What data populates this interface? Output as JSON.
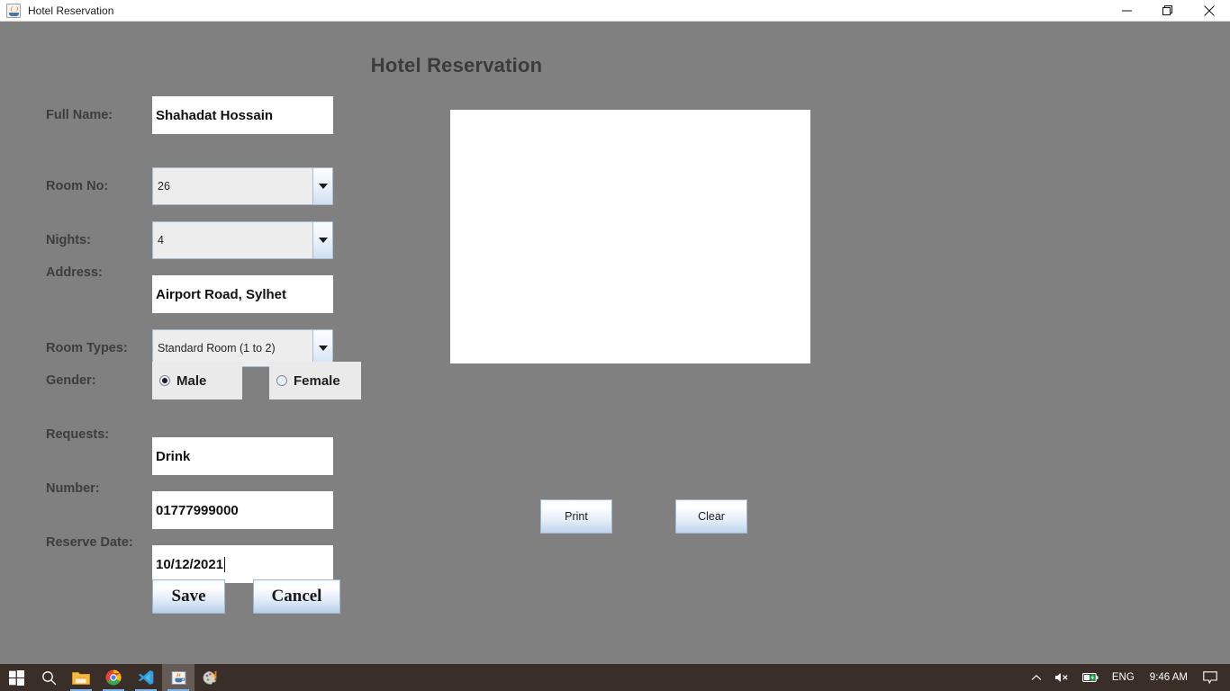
{
  "window": {
    "title": "Hotel Reservation",
    "app_icon": "java-coffee-cup-icon",
    "controls": {
      "minimize": "minimize-icon",
      "restore": "restore-icon",
      "close": "close-icon"
    }
  },
  "page": {
    "heading": "Hotel Reservation"
  },
  "form": {
    "fields": [
      {
        "label": "Full Name:",
        "type": "text",
        "value": "Shahadat Hossain",
        "name": "full-name"
      },
      {
        "label": "Room No:",
        "type": "combo",
        "value": "26",
        "name": "room-no"
      },
      {
        "label": "Nights:",
        "type": "combo",
        "value": "4",
        "name": "nights"
      },
      {
        "label": "Address:",
        "type": "text",
        "value": "Airport Road, Sylhet",
        "name": "address"
      },
      {
        "label": "Room Types:",
        "type": "combo",
        "value": "Standard Room (1 to 2)",
        "name": "room-types"
      },
      {
        "label": "Gender:",
        "type": "radio",
        "value": "Male",
        "name": "gender"
      },
      {
        "label": "Requests:",
        "type": "text",
        "value": "Drink",
        "name": "requests"
      },
      {
        "label": "Number:",
        "type": "text",
        "value": "01777999000",
        "name": "number"
      },
      {
        "label": "Reserve Date:",
        "type": "text",
        "value": "10/12/2021",
        "name": "reserve-date"
      }
    ],
    "gender_options": [
      {
        "label": "Male",
        "selected": true
      },
      {
        "label": "Female",
        "selected": false
      }
    ],
    "buttons": {
      "save": "Save",
      "cancel": "Cancel"
    }
  },
  "preview": {
    "content": "",
    "buttons": {
      "print": "Print",
      "clear": "Clear"
    }
  },
  "taskbar": {
    "items": [
      {
        "name": "start-button",
        "icon": "windows-logo-icon"
      },
      {
        "name": "search-button",
        "icon": "search-icon"
      },
      {
        "name": "file-explorer",
        "icon": "folder-icon"
      },
      {
        "name": "google-chrome",
        "icon": "chrome-icon"
      },
      {
        "name": "visual-studio-code",
        "icon": "vscode-icon"
      },
      {
        "name": "java-application",
        "icon": "java-coffee-cup-icon"
      },
      {
        "name": "paint",
        "icon": "paint-palette-icon"
      }
    ],
    "tray": {
      "overflow": "chevron-up-icon",
      "volume": "speaker-muted-icon",
      "battery": "battery-charging-icon",
      "language": "ENG",
      "clock": "9:46 AM",
      "notifications": "notification-icon"
    }
  },
  "colors": {
    "app_background": "#808080",
    "title_text": "#3b3b3b",
    "field_background": "#ffffff",
    "combo_background": "#ededed",
    "taskbar": "#3a2e28"
  }
}
